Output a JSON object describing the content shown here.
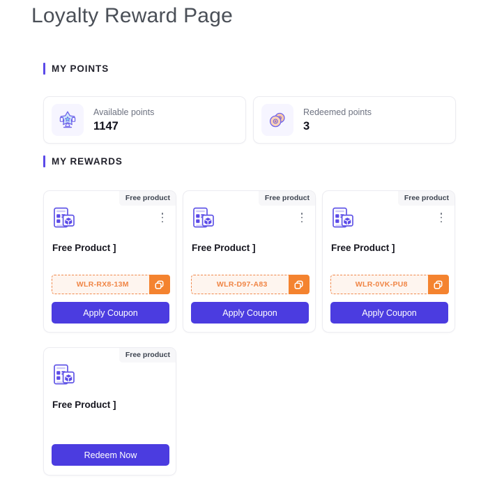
{
  "page": {
    "title": "Loyalty Reward Page"
  },
  "sections": {
    "points_heading": "MY POINTS",
    "rewards_heading": "MY REWARDS"
  },
  "points": [
    {
      "icon": "award-star-icon",
      "label": "Available points",
      "value": "1147"
    },
    {
      "icon": "coins-icon",
      "label": "Redeemed points",
      "value": "3"
    }
  ],
  "rewards": [
    {
      "badge": "Free product",
      "icon": "product-gift-icon",
      "title": "Free Product ]",
      "coupon_code": "WLR-RX8-13M",
      "copy_icon": "copy-icon",
      "menu_icon": "kebab-menu-icon",
      "button_label": "Apply Coupon"
    },
    {
      "badge": "Free product",
      "icon": "product-gift-icon",
      "title": "Free Product ]",
      "coupon_code": "WLR-D97-A83",
      "copy_icon": "copy-icon",
      "menu_icon": "kebab-menu-icon",
      "button_label": "Apply Coupon"
    },
    {
      "badge": "Free product",
      "icon": "product-gift-icon",
      "title": "Free Product ]",
      "coupon_code": "WLR-0VK-PU8",
      "copy_icon": "copy-icon",
      "menu_icon": "kebab-menu-icon",
      "button_label": "Apply Coupon"
    },
    {
      "badge": "Free product",
      "icon": "product-gift-icon",
      "title": "Free Product ]",
      "button_label": "Redeem Now"
    }
  ],
  "colors": {
    "accent_purple": "#4b3ce0",
    "accent_orange": "#f4832f",
    "coupon_bg": "#fef5ef",
    "badge_bg": "#f7f7f9",
    "icon_tile_bg": "#f6f5ff",
    "page_bg": "#ffffff"
  }
}
